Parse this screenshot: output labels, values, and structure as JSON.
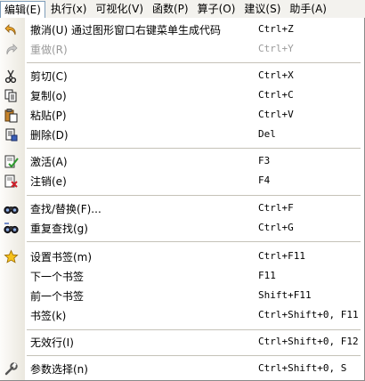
{
  "menubar": {
    "items": [
      {
        "label": "编辑(E)",
        "active": true
      },
      {
        "label": "执行(x)"
      },
      {
        "label": "可视化(V)"
      },
      {
        "label": "函数(P)"
      },
      {
        "label": "算子(O)"
      },
      {
        "label": "建议(S)"
      },
      {
        "label": "助手(A)"
      }
    ]
  },
  "menu": {
    "items": [
      {
        "label": "撤消(U) 通过图形窗口右键菜单生成代码",
        "shortcut": "Ctrl+Z",
        "icon": "undo-icon",
        "enabled": true
      },
      {
        "label": "重做(R)",
        "shortcut": "Ctrl+Y",
        "icon": "redo-icon",
        "enabled": false
      },
      {
        "label": "剪切(C)",
        "shortcut": "Ctrl+X",
        "icon": "scissors-icon",
        "enabled": true
      },
      {
        "label": "复制(o)",
        "shortcut": "Ctrl+C",
        "icon": "copy-icon",
        "enabled": true
      },
      {
        "label": "粘贴(P)",
        "shortcut": "Ctrl+V",
        "icon": "paste-icon",
        "enabled": true
      },
      {
        "label": "删除(D)",
        "shortcut": "Del",
        "icon": "delete-icon",
        "enabled": true
      },
      {
        "label": "激活(A)",
        "shortcut": "F3",
        "icon": "activate-icon",
        "enabled": true
      },
      {
        "label": "注销(e)",
        "shortcut": "F4",
        "icon": "deactivate-icon",
        "enabled": true
      },
      {
        "label": "查找/替换(F)...",
        "shortcut": "Ctrl+F",
        "icon": "binoculars-icon",
        "enabled": true
      },
      {
        "label": "重复查找(g)",
        "shortcut": "Ctrl+G",
        "icon": "binoculars-repeat-icon",
        "enabled": true
      },
      {
        "label": "设置书签(m)",
        "shortcut": "Ctrl+F11",
        "icon": "star-icon",
        "enabled": true
      },
      {
        "label": "下一个书签",
        "shortcut": "F11",
        "icon": "",
        "enabled": true
      },
      {
        "label": "前一个书签",
        "shortcut": "Shift+F11",
        "icon": "",
        "enabled": true
      },
      {
        "label": "书签(k)",
        "shortcut": "Ctrl+Shift+0, F11",
        "icon": "",
        "enabled": true
      },
      {
        "label": "无效行(I)",
        "shortcut": "Ctrl+Shift+0, F12",
        "icon": "",
        "enabled": true
      },
      {
        "label": "参数选择(n)",
        "shortcut": "Ctrl+Shift+0, S",
        "icon": "wrench-icon",
        "enabled": true
      }
    ]
  },
  "colors": {
    "menu_bg": "#ffffff",
    "bar_bg": "#f3f2ee",
    "disabled_text": "#9a9a9a",
    "accent_green": "#2e9a2e",
    "accent_red": "#d0202a"
  }
}
